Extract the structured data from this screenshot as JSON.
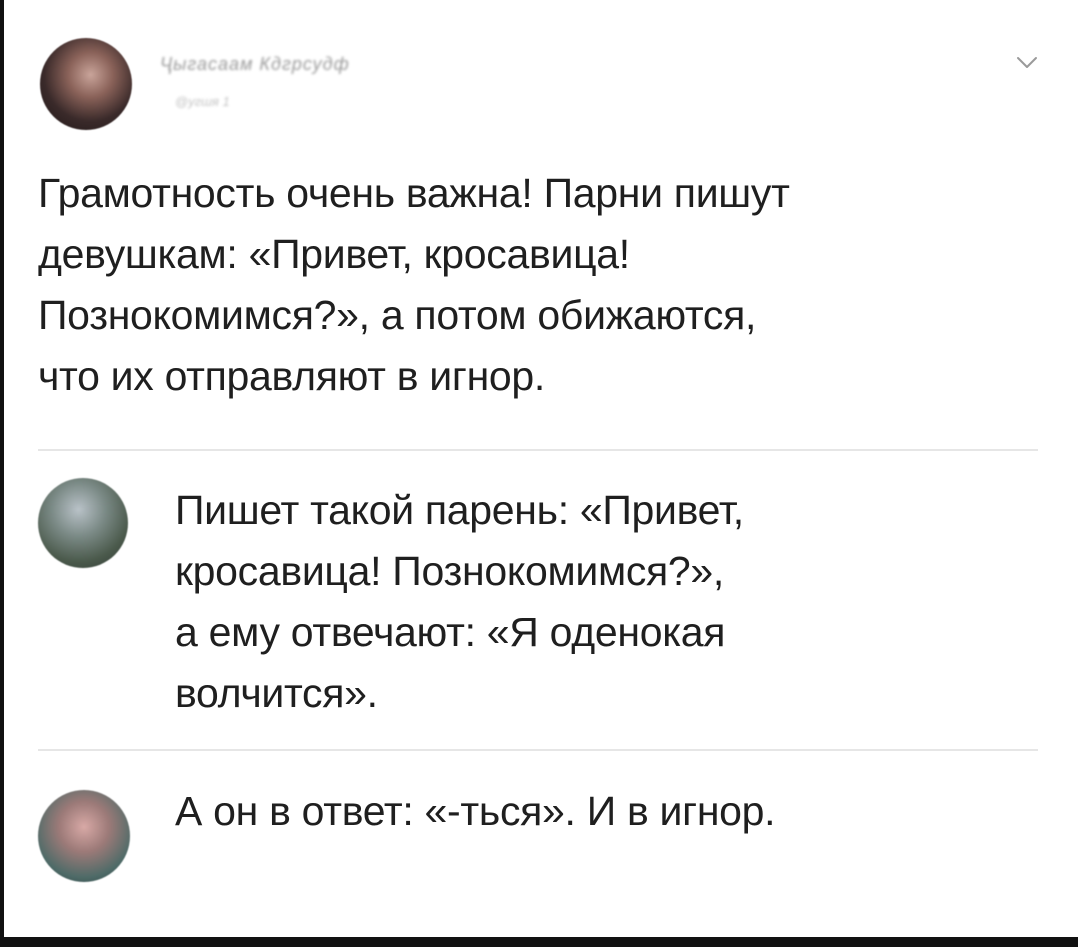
{
  "post": {
    "author": {
      "name": "Ҷыгасаам Кдгрсудф",
      "handle": "@угшя 1"
    },
    "text_lines": [
      "Грамотность очень важна! Парни пишут",
      "девушкам: «Привет, кросавица!",
      "Познокомимся?», а потом обижаются,",
      "что их отправляют в игнор."
    ],
    "menu_icon": "chevron-down-icon"
  },
  "replies": [
    {
      "text_lines": [
        "Пишет такой парень: «Привет,",
        "кросавица! Познокомимся?»,",
        "а ему отвечают: «Я оденокая",
        "волчится»."
      ]
    },
    {
      "text_lines": [
        "А он в ответ: «-ться». И в игнор."
      ]
    }
  ],
  "colors": {
    "background": "#ffffff",
    "text": "#1f1f1f",
    "divider": "#e6e6e6",
    "frame": "#111111"
  }
}
